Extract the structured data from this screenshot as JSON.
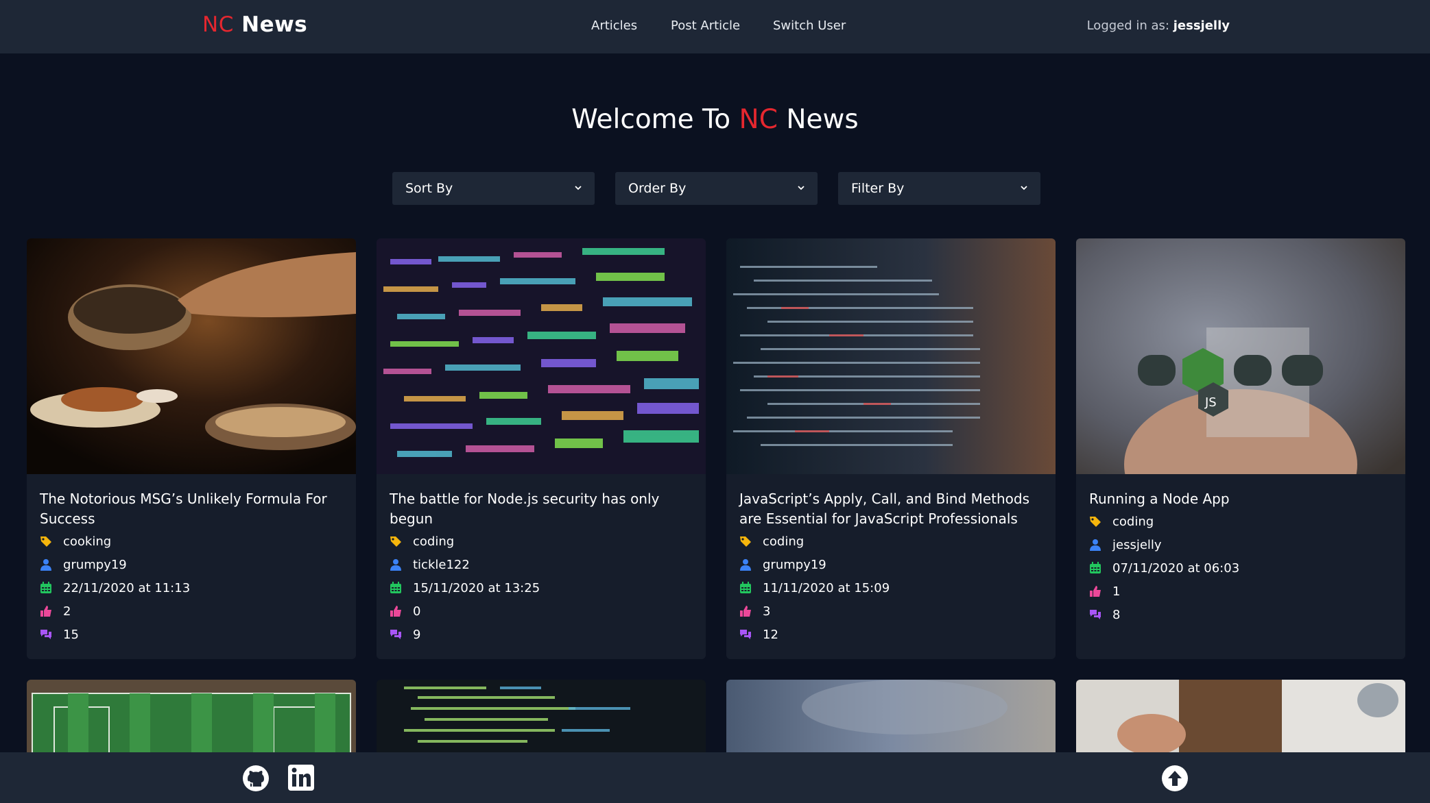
{
  "header": {
    "logo_prefix": "NC",
    "logo_suffix": "News",
    "nav": [
      "Articles",
      "Post Article",
      "Switch User"
    ],
    "logged_in_label": "Logged in as:",
    "logged_in_user": "jessjelly"
  },
  "welcome": {
    "prefix": "Welcome To",
    "highlight": "NC",
    "suffix": "News"
  },
  "filters": {
    "sort_label": "Sort By",
    "order_label": "Order By",
    "filter_label": "Filter By"
  },
  "articles": [
    {
      "title": "The Notorious MSG’s Unlikely Formula For Success",
      "topic": "cooking",
      "author": "grumpy19",
      "date": "22/11/2020 at 11:13",
      "votes": "2",
      "comments": "15"
    },
    {
      "title": "The battle for Node.js security has only begun",
      "topic": "coding",
      "author": "tickle122",
      "date": "15/11/2020 at 13:25",
      "votes": "0",
      "comments": "9"
    },
    {
      "title": "JavaScript’s Apply, Call, and Bind Methods are Essential for JavaScript Professionals",
      "topic": "coding",
      "author": "grumpy19",
      "date": "11/11/2020 at 15:09",
      "votes": "3",
      "comments": "12"
    },
    {
      "title": "Running a Node App",
      "topic": "coding",
      "author": "jessjelly",
      "date": "07/11/2020 at 06:03",
      "votes": "1",
      "comments": "8"
    }
  ],
  "colors": {
    "brand_red": "#e5272f",
    "topic_icon": "#f5b50c",
    "author_icon": "#3b82f6",
    "date_icon": "#22c55e",
    "votes_icon": "#ec4899",
    "comments_icon": "#a855f7"
  },
  "icons": {
    "footer_left": [
      "github-icon",
      "linkedin-icon"
    ],
    "footer_right": "arrow-up-circle-icon"
  }
}
